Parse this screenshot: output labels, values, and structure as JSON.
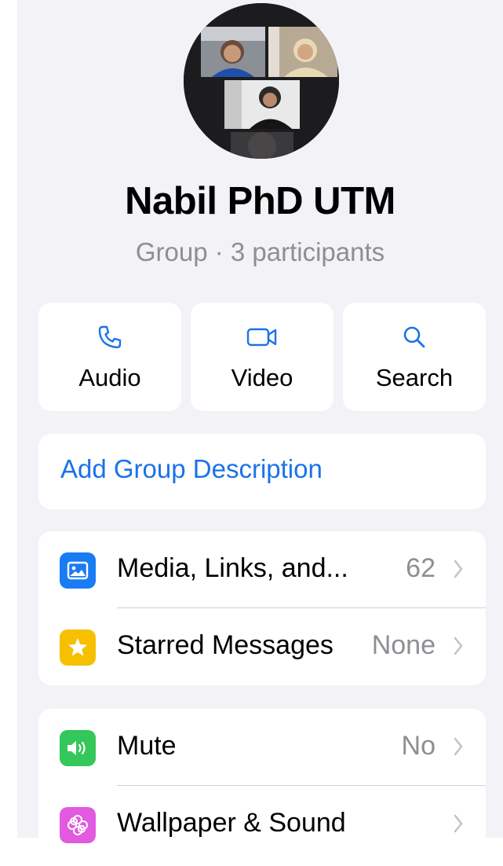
{
  "header": {
    "title": "Nabil PhD UTM",
    "subtitle": "Group · 3 participants"
  },
  "actions": [
    {
      "label": "Audio",
      "icon": "phone-icon"
    },
    {
      "label": "Video",
      "icon": "video-camera-icon"
    },
    {
      "label": "Search",
      "icon": "search-icon"
    }
  ],
  "description": {
    "label": "Add Group Description"
  },
  "section1": [
    {
      "label": "Media, Links, and...",
      "value": "62",
      "icon": "photo-icon",
      "color": "#1a7cf5"
    },
    {
      "label": "Starred Messages",
      "value": "None",
      "icon": "star-icon",
      "color": "#f6c000"
    }
  ],
  "section2": [
    {
      "label": "Mute",
      "value": "No",
      "icon": "speaker-icon",
      "color": "#34c759"
    },
    {
      "label": "Wallpaper & Sound",
      "value": "",
      "icon": "flower-icon",
      "color": "#e25ae0"
    }
  ],
  "colors": {
    "accent": "#1a73e8",
    "background": "#f2f2f7",
    "secondary_text": "#8e8e93"
  }
}
